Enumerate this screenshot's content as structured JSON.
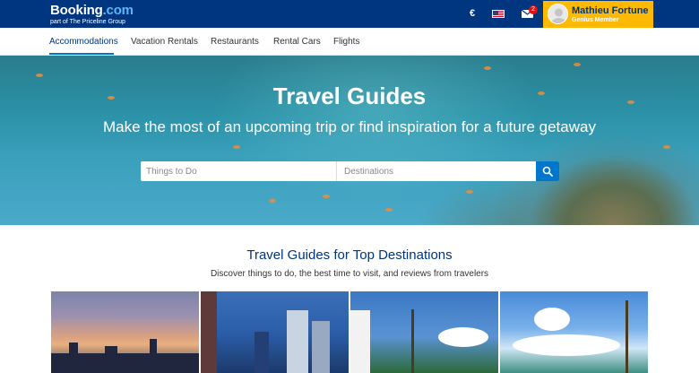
{
  "header": {
    "logo_main": "Booking",
    "logo_suffix": ".com",
    "logo_sub": "part of The Priceline Group",
    "currency": "€",
    "messages_count": "2",
    "user_name": "Mathieu Fortune",
    "user_tier": "Genius Member"
  },
  "nav": {
    "items": [
      "Accommodations",
      "Vacation Rentals",
      "Restaurants",
      "Rental Cars",
      "Flights"
    ],
    "active": "Accommodations"
  },
  "hero": {
    "title": "Travel Guides",
    "subtitle": "Make the most of an upcoming trip or find inspiration for a future getaway",
    "search_todo_placeholder": "Things to Do",
    "search_dest_placeholder": "Destinations"
  },
  "section": {
    "title": "Travel Guides for Top Destinations",
    "subtitle": "Discover things to do, the best time to visit, and reviews from travelers"
  },
  "colors": {
    "brand_dark": "#003580",
    "brand_light": "#0077cc",
    "genius_yellow": "#feba02",
    "badge_red": "#e21111"
  }
}
